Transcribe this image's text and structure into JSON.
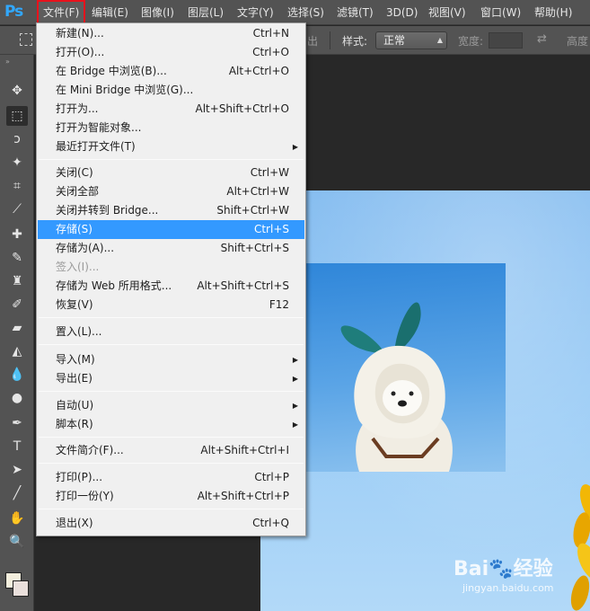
{
  "app": {
    "logo": "Ps"
  },
  "menubar": {
    "items": [
      "文件(F)",
      "编辑(E)",
      "图像(I)",
      "图层(L)",
      "文字(Y)",
      "选择(S)",
      "滤镜(T)",
      "3D(D)",
      "视图(V)",
      "窗口(W)",
      "帮助(H)"
    ],
    "active_index": 0
  },
  "options": {
    "partial_label": "出",
    "style_label": "样式:",
    "style_value": "正常",
    "width_label": "宽度:",
    "height_label": "高度"
  },
  "file_menu": {
    "items": [
      {
        "label": "新建(N)...",
        "shortcut": "Ctrl+N"
      },
      {
        "label": "打开(O)...",
        "shortcut": "Ctrl+O"
      },
      {
        "label": "在 Bridge 中浏览(B)...",
        "shortcut": "Alt+Ctrl+O"
      },
      {
        "label": "在 Mini Bridge 中浏览(G)...",
        "shortcut": ""
      },
      {
        "label": "打开为...",
        "shortcut": "Alt+Shift+Ctrl+O"
      },
      {
        "label": "打开为智能对象...",
        "shortcut": ""
      },
      {
        "label": "最近打开文件(T)",
        "shortcut": ""
      },
      {
        "label": "关闭(C)",
        "shortcut": "Ctrl+W"
      },
      {
        "label": "关闭全部",
        "shortcut": "Alt+Ctrl+W"
      },
      {
        "label": "关闭并转到 Bridge...",
        "shortcut": "Shift+Ctrl+W"
      },
      {
        "label": "存储(S)",
        "shortcut": "Ctrl+S"
      },
      {
        "label": "存储为(A)...",
        "shortcut": "Shift+Ctrl+S"
      },
      {
        "label": "签入(I)...",
        "shortcut": ""
      },
      {
        "label": "存储为 Web 所用格式...",
        "shortcut": "Alt+Shift+Ctrl+S"
      },
      {
        "label": "恢复(V)",
        "shortcut": "F12"
      },
      {
        "label": "置入(L)...",
        "shortcut": ""
      },
      {
        "label": "导入(M)",
        "shortcut": ""
      },
      {
        "label": "导出(E)",
        "shortcut": ""
      },
      {
        "label": "自动(U)",
        "shortcut": ""
      },
      {
        "label": "脚本(R)",
        "shortcut": ""
      },
      {
        "label": "文件简介(F)...",
        "shortcut": "Alt+Shift+Ctrl+I"
      },
      {
        "label": "打印(P)...",
        "shortcut": "Ctrl+P"
      },
      {
        "label": "打印一份(Y)",
        "shortcut": "Alt+Shift+Ctrl+P"
      },
      {
        "label": "退出(X)",
        "shortcut": "Ctrl+Q"
      }
    ],
    "highlighted_label": "存储(S)",
    "disabled_label": "签入(I)..."
  },
  "watermark": {
    "brand": "Bai",
    "brand_suffix": "经验",
    "url": "jingyan.baidu.com"
  },
  "colors": {
    "highlight": "#3399ff",
    "active_outline": "#e8121c",
    "logo": "#31a8ff"
  }
}
